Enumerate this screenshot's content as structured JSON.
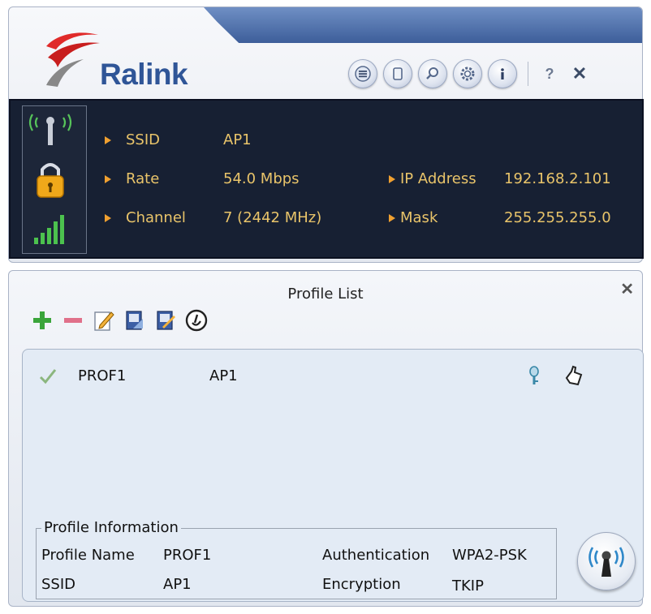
{
  "app": {
    "brand": "Ralink",
    "toolbar": {
      "buttons": [
        {
          "name": "list-icon"
        },
        {
          "name": "page-icon"
        },
        {
          "name": "search-icon"
        },
        {
          "name": "gear-icon"
        },
        {
          "name": "info-icon"
        }
      ],
      "help_label": "?",
      "close_label": "✕"
    }
  },
  "status": {
    "ssid_label": "SSID",
    "ssid_value": "AP1",
    "rate_label": "Rate",
    "rate_value": "54.0 Mbps",
    "channel_label": "Channel",
    "channel_value": "7 (2442 MHz)",
    "ip_label": "IP Address",
    "ip_value": "192.168.2.101",
    "mask_label": "Mask",
    "mask_value": "255.255.255.0",
    "text_color": "#e9c46a",
    "bullet_color": "#f0a030",
    "panel_color": "#172033"
  },
  "profile_list": {
    "title": "Profile List",
    "close_label": "✕",
    "tools": [
      "add-icon",
      "remove-icon",
      "edit-icon",
      "import-icon",
      "export-icon",
      "activate-icon"
    ],
    "profiles": [
      {
        "name": "PROF1",
        "ssid": "AP1",
        "active": true
      }
    ],
    "info": {
      "legend": "Profile Information",
      "profile_name_label": "Profile Name",
      "profile_name_value": "PROF1",
      "ssid_label": "SSID",
      "ssid_value": "AP1",
      "auth_label": "Authentication",
      "auth_value": "WPA2-PSK",
      "enc_label": "Encryption",
      "enc_value": "TKIP"
    }
  }
}
